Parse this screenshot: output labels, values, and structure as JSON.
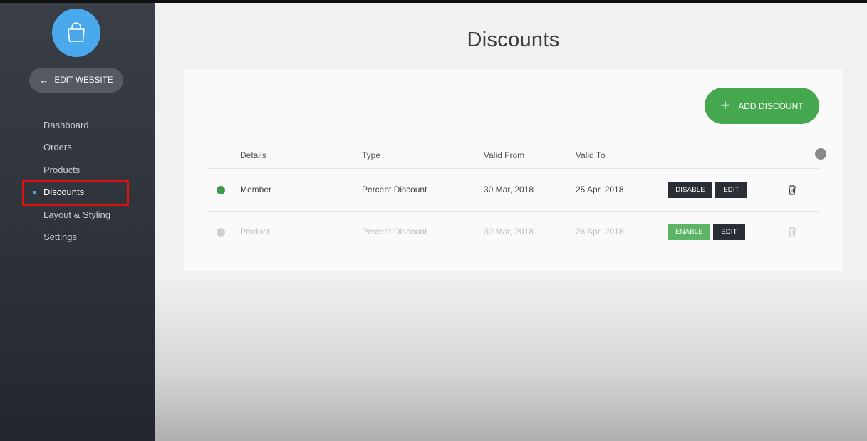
{
  "sidebar": {
    "logo_icon": "shopping-bag-icon",
    "edit_website": {
      "arrow": "←",
      "label": "EDIT WEBSITE"
    },
    "nav": [
      {
        "label": "Dashboard"
      },
      {
        "label": "Orders"
      },
      {
        "label": "Products"
      },
      {
        "label": "Discounts",
        "active": true
      },
      {
        "label": "Layout & Styling"
      },
      {
        "label": "Settings"
      }
    ]
  },
  "main": {
    "title": "Discounts",
    "add_button": {
      "plus": "+",
      "label": "ADD DISCOUNT"
    },
    "columns": {
      "details": "Details",
      "type": "Type",
      "valid_from": "Valid From",
      "valid_to": "Valid To"
    },
    "rows": [
      {
        "details": "Member",
        "type": "Percent Discount",
        "valid_from": "30 Mar, 2018",
        "valid_to": "25 Apr, 2018",
        "status": "enabled",
        "status_color": "#3d9a4a",
        "toggle_label": "DISABLE",
        "edit_label": "EDIT"
      },
      {
        "details": "Product",
        "type": "Percent Discount",
        "valid_from": "30 Mar, 2018",
        "valid_to": "26 Apr, 2018",
        "status": "disabled",
        "status_color": "#cfcfcf",
        "toggle_label": "ENABLE",
        "edit_label": "EDIT"
      }
    ]
  },
  "colors": {
    "accent": "#4aa8ec",
    "primary_green": "#46a84e",
    "highlight_box": "#e01010"
  }
}
